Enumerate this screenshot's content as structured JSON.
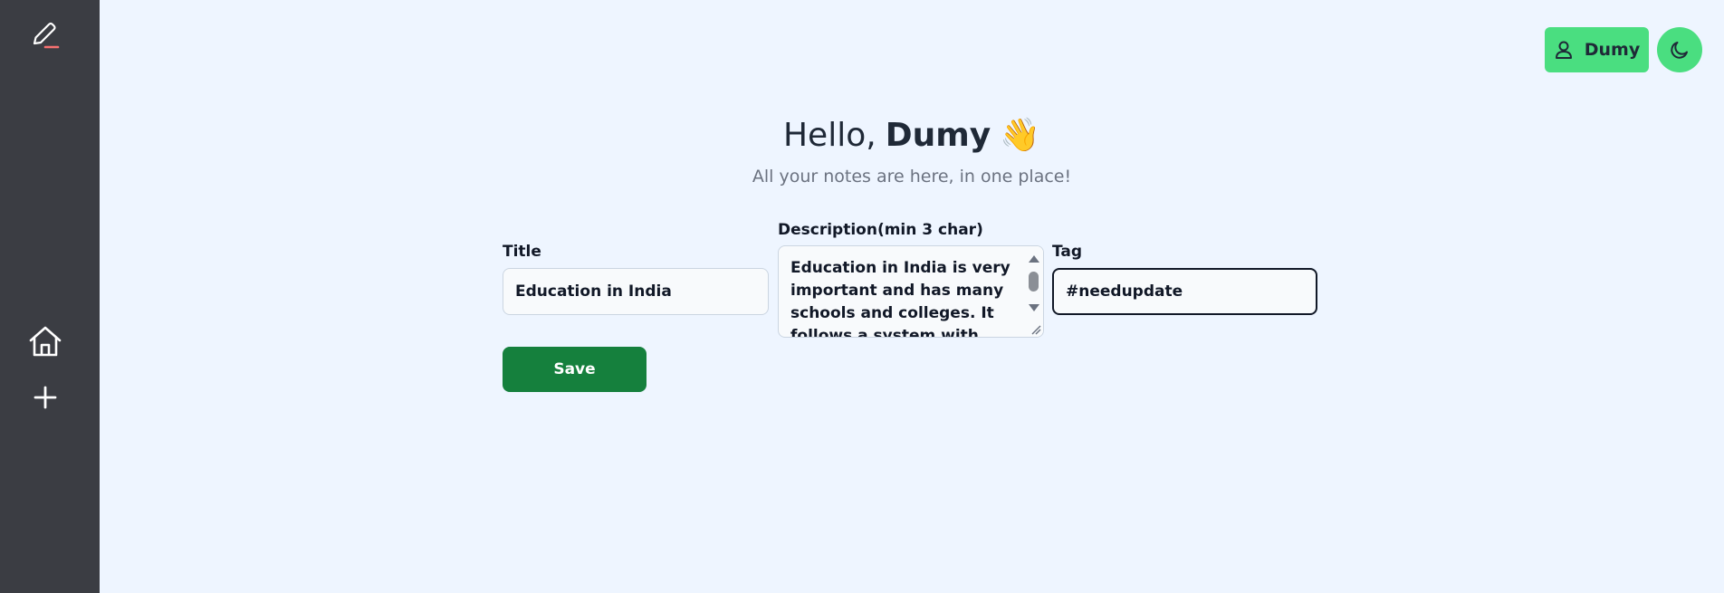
{
  "sidebar": {
    "logo_icon": "pencil-icon",
    "items": [
      {
        "icon": "home-icon"
      },
      {
        "icon": "plus-icon"
      }
    ]
  },
  "header": {
    "user_label": "Dumy",
    "user_icon": "user-icon",
    "theme_icon": "moon-icon"
  },
  "hero": {
    "greeting_prefix": "Hello,",
    "greeting_name": "Dumy",
    "greeting_emoji": "👋",
    "subtitle": "All your notes are here, in one place!"
  },
  "form": {
    "title_label": "Title",
    "title_value": "Education in India",
    "description_label": "Description(min 3 char)",
    "description_value": "Education in India is very important and has many schools and colleges. It follows a system with primary",
    "tag_label": "Tag",
    "tag_value": "#needupdate",
    "save_label": "Save"
  },
  "colors": {
    "sidebar_bg": "#3b3d43",
    "page_bg": "#eef5ff",
    "accent_green": "#4ade80",
    "save_green": "#15803d"
  }
}
